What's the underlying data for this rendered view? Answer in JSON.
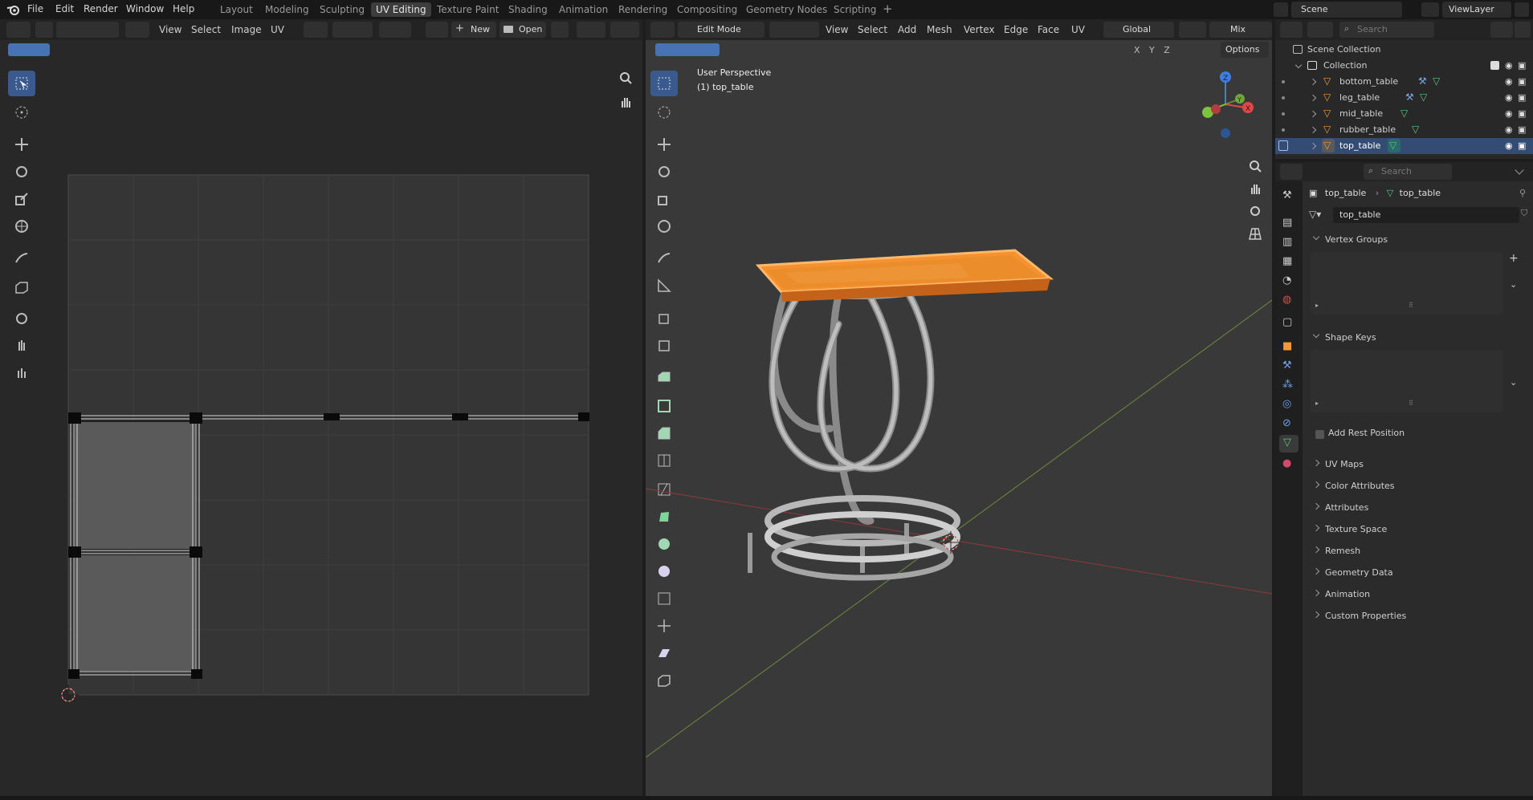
{
  "topbar": {
    "menus": [
      "File",
      "Edit",
      "Render",
      "Window",
      "Help"
    ],
    "workspaces": [
      "Layout",
      "Modeling",
      "Sculpting",
      "UV Editing",
      "Texture Paint",
      "Shading",
      "Animation",
      "Rendering",
      "Compositing",
      "Geometry Nodes",
      "Scripting"
    ],
    "active_workspace": "UV Editing",
    "scene": "Scene",
    "view_layer": "ViewLayer"
  },
  "uv_editor": {
    "menus": [
      "View",
      "Select",
      "Image",
      "UV"
    ],
    "new_label": "New",
    "open_label": "Open"
  },
  "viewport": {
    "mode": "Edit Mode",
    "menus": [
      "View",
      "Select",
      "Add",
      "Mesh",
      "Vertex",
      "Edge",
      "Face",
      "UV"
    ],
    "orientation": "Global",
    "proportional": "Mix",
    "options_label": "Options",
    "axes": [
      "X",
      "Y",
      "Z"
    ],
    "overlay_title": "User Perspective",
    "overlay_object": "(1) top_table",
    "accent": "#f5922f"
  },
  "outliner": {
    "search_placeholder": "Search",
    "scene_collection": "Scene Collection",
    "collection": "Collection",
    "objects": [
      {
        "name": "bottom_table",
        "selected": false
      },
      {
        "name": "leg_table",
        "selected": false
      },
      {
        "name": "mid_table",
        "selected": false
      },
      {
        "name": "rubber_table",
        "selected": false
      },
      {
        "name": "top_table",
        "selected": true
      }
    ]
  },
  "properties": {
    "search_placeholder": "Search",
    "breadcrumb_object": "top_table",
    "breadcrumb_data": "top_table",
    "data_name": "top_table",
    "vertex_groups_label": "Vertex Groups",
    "shape_keys_label": "Shape Keys",
    "add_rest_position": "Add Rest Position",
    "panels": [
      "UV Maps",
      "Color Attributes",
      "Attributes",
      "Texture Space",
      "Remesh",
      "Geometry Data",
      "Animation",
      "Custom Properties"
    ]
  }
}
